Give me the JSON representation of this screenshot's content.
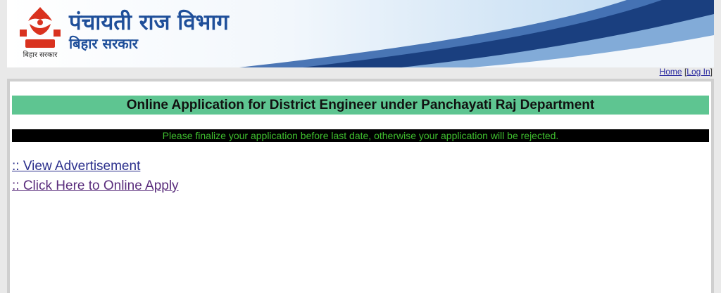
{
  "header": {
    "title": "पंचायती राज विभाग",
    "subtitle": "बिहार सरकार",
    "emblem_caption": "बिहार सरकार",
    "emblem_icon": "bihar-emblem-icon"
  },
  "nav": {
    "home": "Home",
    "login": "Log In",
    "open_bracket": "[",
    "close_bracket": "]"
  },
  "main": {
    "heading": "Online Application for District Engineer under Panchayati Raj Department",
    "notice": "Please finalize your application before last date, otherwise your application will be rejected.",
    "links": [
      {
        "label": ":: View Advertisement "
      },
      {
        "label": ":: Click Here to Online Apply "
      }
    ]
  },
  "colors": {
    "heading_bg": "#5ec591",
    "notice_bg": "#000000",
    "notice_text": "#3fbf2f",
    "brand_blue": "#1f4f9a"
  }
}
